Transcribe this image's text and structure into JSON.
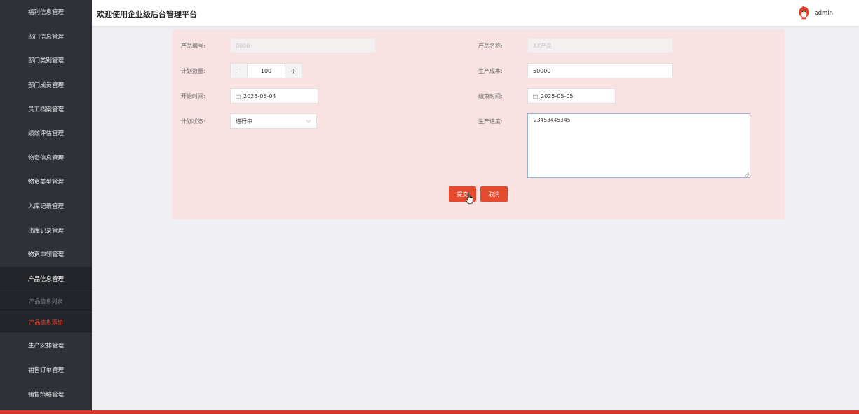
{
  "header": {
    "title": "欢迎使用企业级后台管理平台",
    "username": "admin"
  },
  "sidebar": {
    "items": [
      "福利信息管理",
      "部门信息管理",
      "部门类别管理",
      "部门成员管理",
      "员工档案管理",
      "绩效评估管理",
      "物资信息管理",
      "物资类型管理",
      "入库记录管理",
      "出库记录管理",
      "物资申领管理",
      "产品信息管理"
    ],
    "submenu": [
      "产品信息列表",
      "产品信息添加"
    ],
    "items_after": [
      "生产安排管理",
      "销售订单管理",
      "销售策略管理"
    ]
  },
  "form": {
    "product_no_label": "产品编号:",
    "product_no_value": "0000",
    "product_name_label": "产品名称:",
    "product_name_value": "XX产品",
    "plan_qty_label": "计划数量:",
    "plan_qty_value": "100",
    "minus": "−",
    "plus": "+",
    "cost_label": "生产成本:",
    "cost_value": "50000",
    "start_label": "开始时间:",
    "start_value": "2025-05-04",
    "end_label": "结束时间:",
    "end_value": "2025-05-05",
    "status_label": "计划状态:",
    "status_value": "进行中",
    "progress_label": "生产进度:",
    "progress_value": "23453445345",
    "submit": "提交",
    "cancel": "取消"
  },
  "colors": {
    "accent": "#e54a2f",
    "sidebar": "#2f3138",
    "panel": "#f8e2e2"
  }
}
